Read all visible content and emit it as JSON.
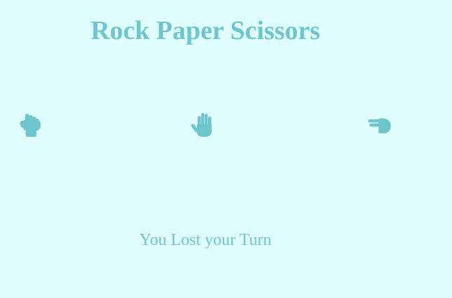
{
  "game": {
    "title": "Rock Paper Scissors",
    "result_text": "You Lost your Turn",
    "choices": [
      {
        "name": "rock",
        "icon": "hand-rock-icon"
      },
      {
        "name": "paper",
        "icon": "hand-paper-icon"
      },
      {
        "name": "scissors",
        "icon": "hand-scissors-icon"
      }
    ]
  },
  "colors": {
    "background": "#e0fdfd",
    "accent": "#6ec6cc"
  }
}
